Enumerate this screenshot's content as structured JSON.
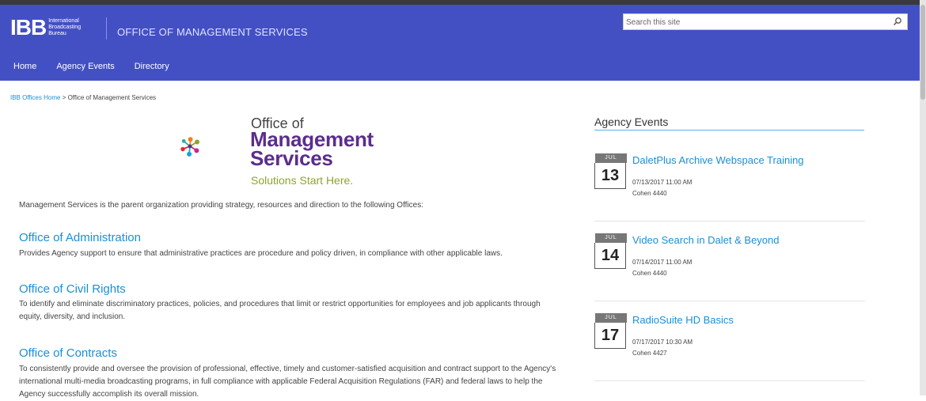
{
  "header": {
    "logo_text": "IBB",
    "logo_lines": [
      "International",
      "Broadcasting",
      "Bureau"
    ],
    "site_title": "OFFICE OF MANAGEMENT SERVICES",
    "search_placeholder": "Search this site"
  },
  "nav": [
    {
      "label": "Home"
    },
    {
      "label": "Agency Events"
    },
    {
      "label": "Directory"
    }
  ],
  "breadcrumb": {
    "home": "IBB Offices Home",
    "separator": " > ",
    "current": "Office of Management Services"
  },
  "oms_logo": {
    "line1": "Office of",
    "line2": "Management",
    "line3": "Services",
    "tagline": "Solutions Start Here."
  },
  "intro": "Management Services is the parent organization providing strategy, resources and direction to the following Offices:",
  "sections": [
    {
      "title": "Office of Administration",
      "text": "Provides Agency support to ensure that administrative practices are procedure and policy driven, in compliance with other applicable laws."
    },
    {
      "title": "Office of Civil Rights",
      "text": "To identify and eliminate discriminatory practices, policies, and procedures that limit or restrict opportunities for employees and job applicants through equity, diversity, and inclusion."
    },
    {
      "title": "Office of Contracts",
      "text": "To consistently provide and oversee the provision of professional, effective, timely and customer-satisfied acquisition and contract support to the Agency's international multi-media broadcasting programs, in full compliance with applicable Federal Acquisition Regulations (FAR) and federal laws to help the Agency successfully accomplish its overall mission."
    }
  ],
  "events_panel": {
    "title": "Agency Events",
    "events": [
      {
        "month": "JUL",
        "day": "13",
        "title": "DaletPlus Archive Webspace Training",
        "datetime": "07/13/2017 11:00 AM",
        "location": "Cohen 4440"
      },
      {
        "month": "JUL",
        "day": "14",
        "title": "Video Search in Dalet & Beyond",
        "datetime": "07/14/2017 11:00 AM",
        "location": "Cohen 4440"
      },
      {
        "month": "JUL",
        "day": "17",
        "title": "RadioSuite HD Basics",
        "datetime": "07/17/2017 10:30 AM",
        "location": "Cohen 4427"
      }
    ]
  },
  "colors": {
    "header_bg": "#4350c4",
    "link": "#1a8fd6",
    "brand_purple": "#5b2d8e",
    "tagline_green": "#8ca52c"
  }
}
